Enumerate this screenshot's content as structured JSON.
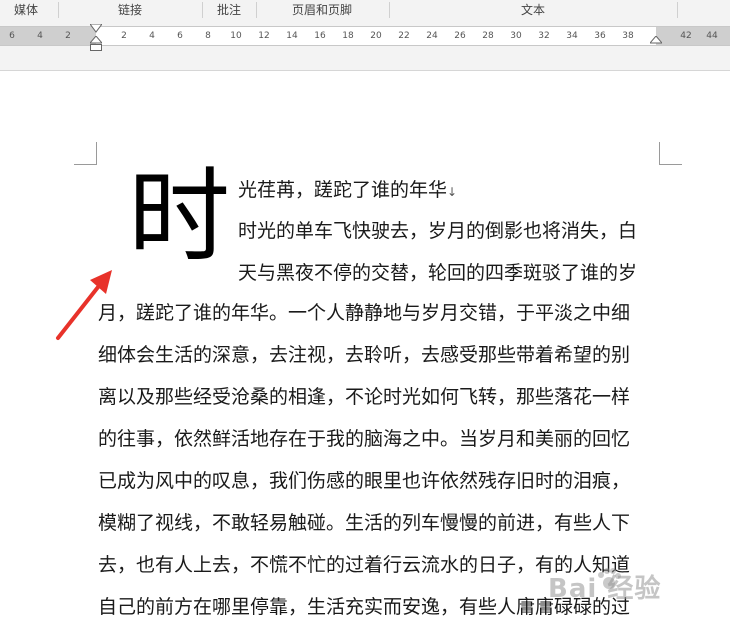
{
  "ribbon": {
    "groups": [
      "媒体",
      "链接",
      "批注",
      "页眉和页脚",
      "文本"
    ]
  },
  "ruler": {
    "ticks": [
      "6",
      "4",
      "2",
      "2",
      "4",
      "6",
      "8",
      "10",
      "12",
      "14",
      "16",
      "18",
      "20",
      "22",
      "24",
      "26",
      "28",
      "30",
      "32",
      "34",
      "36",
      "38",
      "42",
      "44"
    ]
  },
  "document": {
    "drop_cap": "时",
    "lines": [
      "光荏苒，蹉跎了谁的年华",
      "时光的单车飞快驶去，岁月的倒影也将消失，白",
      "天与黑夜不停的交替，轮回的四季斑驳了谁的岁",
      "月，蹉跎了谁的年华。一个人静静地与岁月交错，于平淡之中细",
      "细体会生活的深意，去注视，去聆听，去感受那些带着希望的别",
      "离以及那些经受沧桑的相逢，不论时光如何飞转，那些落花一样",
      "的往事，依然鲜活地存在于我的脑海之中。当岁月和美丽的回忆",
      "已成为风中的叹息，我们伤感的眼里也许依然残存旧时的泪痕，",
      "模糊了视线，不敢轻易触碰。生活的列车慢慢的前进，有些人下",
      "去，也有人上去，不慌不忙的过着行云流水的日子，有的人知道",
      "自己的前方在哪里停靠，生活充实而安逸，有些人庸庸碌碌的过"
    ],
    "paragraph_mark": "↓"
  },
  "watermark": {
    "text": "Bai 经验"
  },
  "colors": {
    "arrow": "#e8322a",
    "ribbon_bg": "#f3f3f3",
    "ruler_margin": "#cfcfcf"
  }
}
